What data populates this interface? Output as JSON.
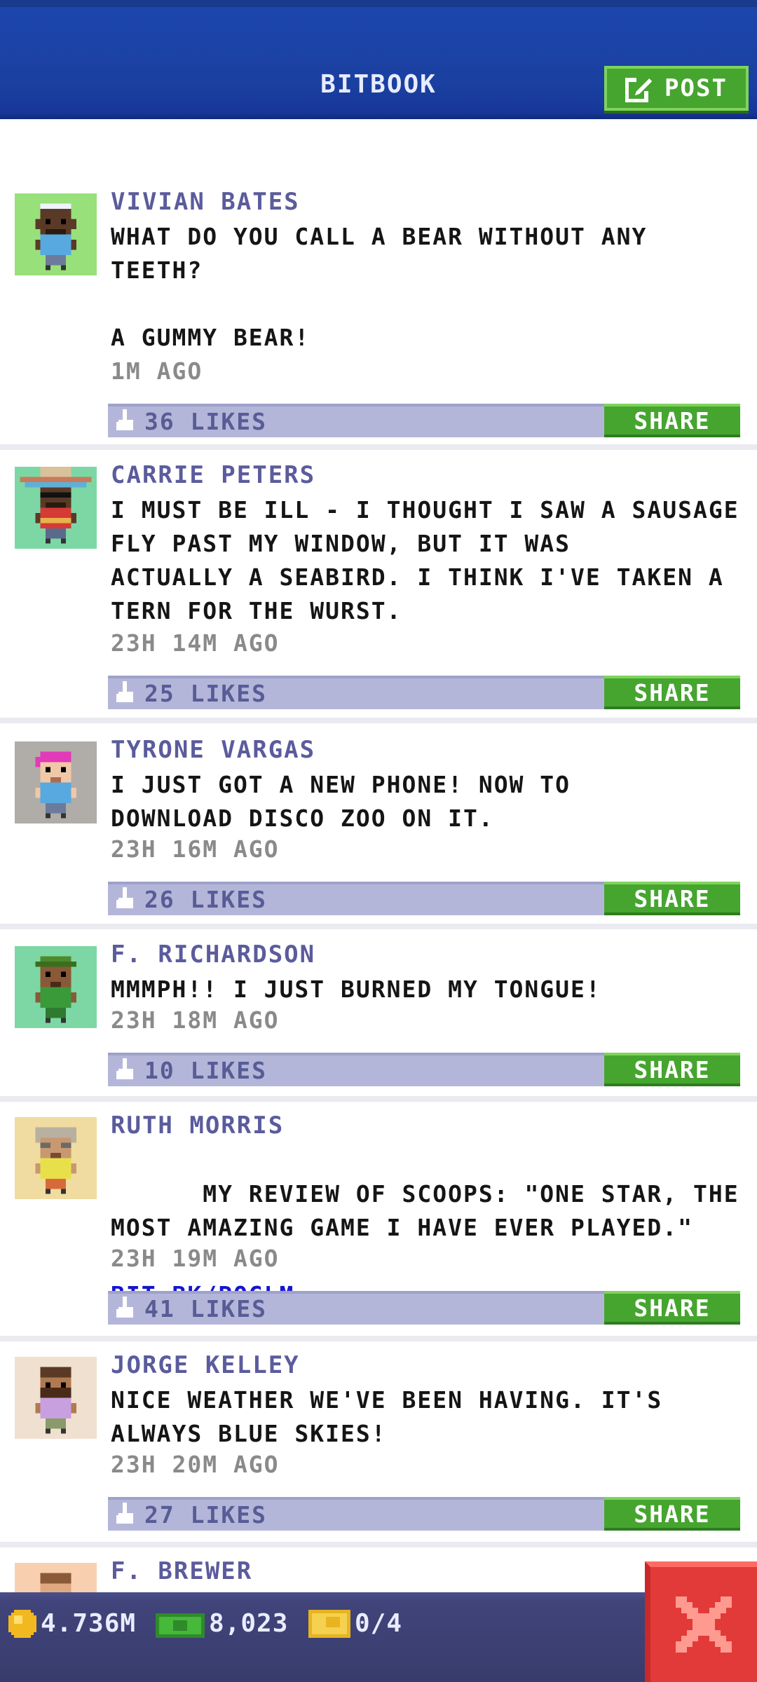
{
  "header": {
    "title": "BITBOOK",
    "post_label": "POST"
  },
  "posts": [
    {
      "name": "VIVIAN BATES",
      "text": "WHAT DO YOU CALL A BEAR WITHOUT ANY\nTEETH?\n\nA GUMMY BEAR!",
      "time": "1M AGO",
      "likes": "36 LIKES",
      "share_label": "SHARE",
      "avatar_icon": "avatar-green-bg-headphones"
    },
    {
      "name": "CARRIE PETERS",
      "text": "I MUST BE ILL - I THOUGHT I SAW A SAUSAGE\nFLY PAST MY WINDOW, BUT IT WAS\nACTUALLY A SEABIRD. I THINK I'VE TAKEN A\nTERN FOR THE WURST.",
      "time": "23H 14M AGO",
      "likes": "25 LIKES",
      "share_label": "SHARE",
      "avatar_icon": "avatar-sombrero-sunglasses"
    },
    {
      "name": "TYRONE VARGAS",
      "text": "I JUST GOT A NEW PHONE! NOW TO\nDOWNLOAD DISCO ZOO ON IT.",
      "time": "23H 16M AGO",
      "likes": "26 LIKES",
      "share_label": "SHARE",
      "avatar_icon": "avatar-pink-hair"
    },
    {
      "name": "F. RICHARDSON",
      "text": "MMMPH!! I JUST BURNED MY TONGUE!",
      "time": "23H 18M AGO",
      "likes": "10 LIKES",
      "share_label": "SHARE",
      "avatar_icon": "avatar-green-cap"
    },
    {
      "name": "RUTH MORRIS",
      "text": "MY REVIEW OF SCOOPS: \"ONE STAR, THE\nMOST AMAZING GAME I HAVE EVER PLAYED.\"",
      "link": "BIT.BK/PQGLM",
      "time": "23H 19M AGO",
      "likes": "41 LIKES",
      "share_label": "SHARE",
      "avatar_icon": "avatar-grey-hair-glasses"
    },
    {
      "name": "JORGE KELLEY",
      "text": "NICE WEATHER WE'VE BEEN HAVING. IT'S\nALWAYS BLUE SKIES!",
      "time": "23H 20M AGO",
      "likes": "27 LIKES",
      "share_label": "SHARE",
      "avatar_icon": "avatar-beard"
    },
    {
      "name": "F. BREWER",
      "avatar_icon": "avatar-peach-bg"
    }
  ],
  "bottom": {
    "coins": "4.736M",
    "cash": "8,023",
    "tickets": "0/4"
  },
  "colors": {
    "header_blue": "#1d46ad",
    "button_green": "#46a52f",
    "like_bar": "#b4b6d9",
    "name_purple": "#5b5b9d",
    "close_red": "#e23a38"
  }
}
